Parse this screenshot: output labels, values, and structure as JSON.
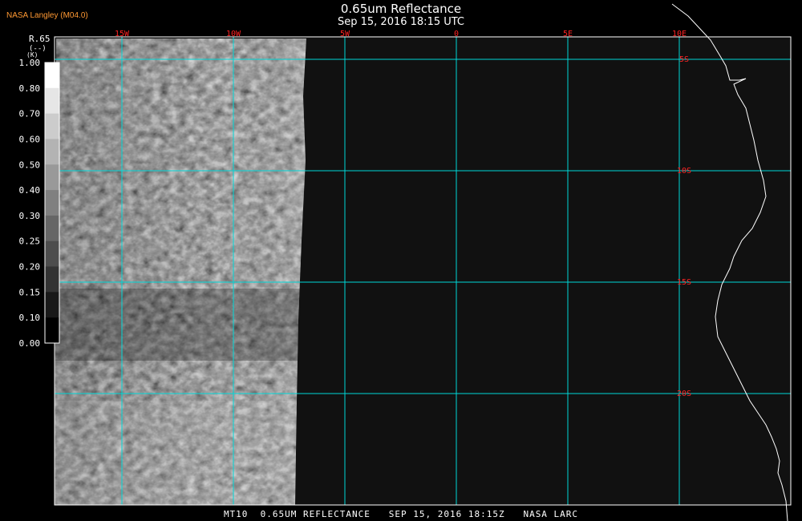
{
  "header": {
    "title": "0.65um Reflectance",
    "datetime": "Sep 15, 2016 18:15 UTC",
    "credit": "NASA Langley (M04.0)"
  },
  "footer": {
    "caption": "MT10  0.65UM REFLECTANCE   SEP 15, 2016 18:15Z   NASA LARC"
  },
  "legend": {
    "variable": "R.65",
    "units": "(--)",
    "units_letter": "(K)",
    "ticks": [
      "1.00",
      "0.80",
      "0.70",
      "0.60",
      "0.50",
      "0.40",
      "0.30",
      "0.25",
      "0.20",
      "0.15",
      "0.10",
      "0.00"
    ]
  },
  "map": {
    "lon_labels": [
      "15W",
      "10W",
      "5W",
      "0",
      "5E",
      "10E"
    ],
    "lat_labels": [
      "5S",
      "10S",
      "15S",
      "20S"
    ],
    "colors": {
      "grid": "#00d8d8",
      "lon_label": "#ff2222",
      "lat_label": "#ff2222",
      "coastline": "#ffffff",
      "no_data": "#111111"
    }
  }
}
